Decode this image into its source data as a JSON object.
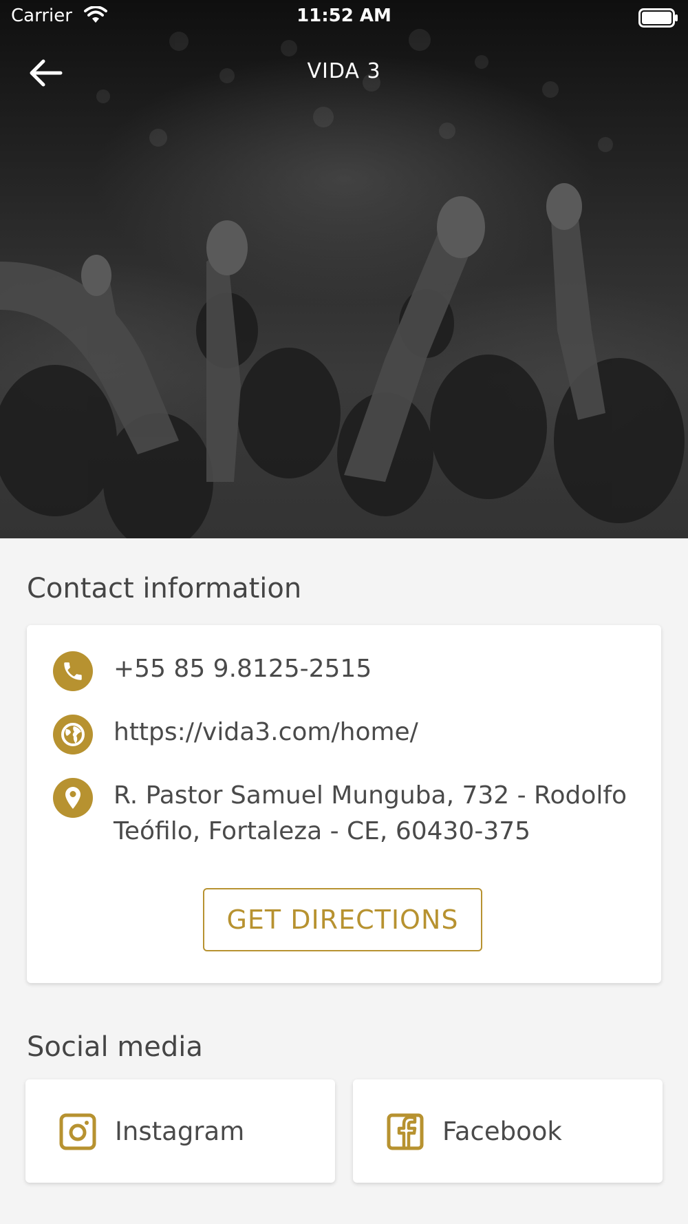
{
  "status_bar": {
    "carrier": "Carrier",
    "time": "11:52 AM"
  },
  "nav": {
    "title": "VIDA 3"
  },
  "contact": {
    "heading": "Contact information",
    "phone": "+55 85 9.8125-2515",
    "website": "https://vida3.com/home/",
    "address_line1": "R. Pastor Samuel Munguba, 732 - Rodolfo",
    "address_line2": "Teófilo, Fortaleza - CE, 60430-375",
    "directions_label": "GET DIRECTIONS"
  },
  "social": {
    "heading": "Social media",
    "items": [
      {
        "label": "Instagram",
        "icon": "instagram-icon"
      },
      {
        "label": "Facebook",
        "icon": "facebook-icon"
      }
    ]
  },
  "colors": {
    "accent": "#b79230",
    "background": "#f4f4f4",
    "card": "#ffffff"
  }
}
